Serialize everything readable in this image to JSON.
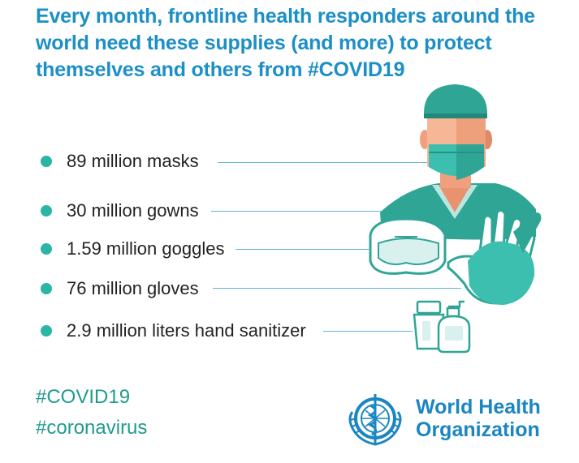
{
  "headline": "Every month, frontline health responders around the world need these supplies (and more) to protect themselves and others from #COVID19",
  "supplies": [
    {
      "label": "89 million masks"
    },
    {
      "label": "30 million gowns"
    },
    {
      "label": "1.59 million goggles"
    },
    {
      "label": "76 million gloves"
    },
    {
      "label": "2.9 million liters hand sanitizer"
    }
  ],
  "hashtags": [
    "#COVID19",
    "#coronavirus"
  ],
  "logo": {
    "line1": "World Health",
    "line2": "Organization"
  },
  "colors": {
    "headline": "#1c8fc7",
    "bullet": "#2bb5a4",
    "leader_line": "#5fb4dc",
    "scrubs": "#2fa596",
    "hashtag": "#1f9b8c",
    "who_blue": "#1a86c2"
  },
  "icons": [
    "health-worker-icon",
    "goggles-icon",
    "glove-icon",
    "sanitizer-icon",
    "who-emblem-icon"
  ]
}
